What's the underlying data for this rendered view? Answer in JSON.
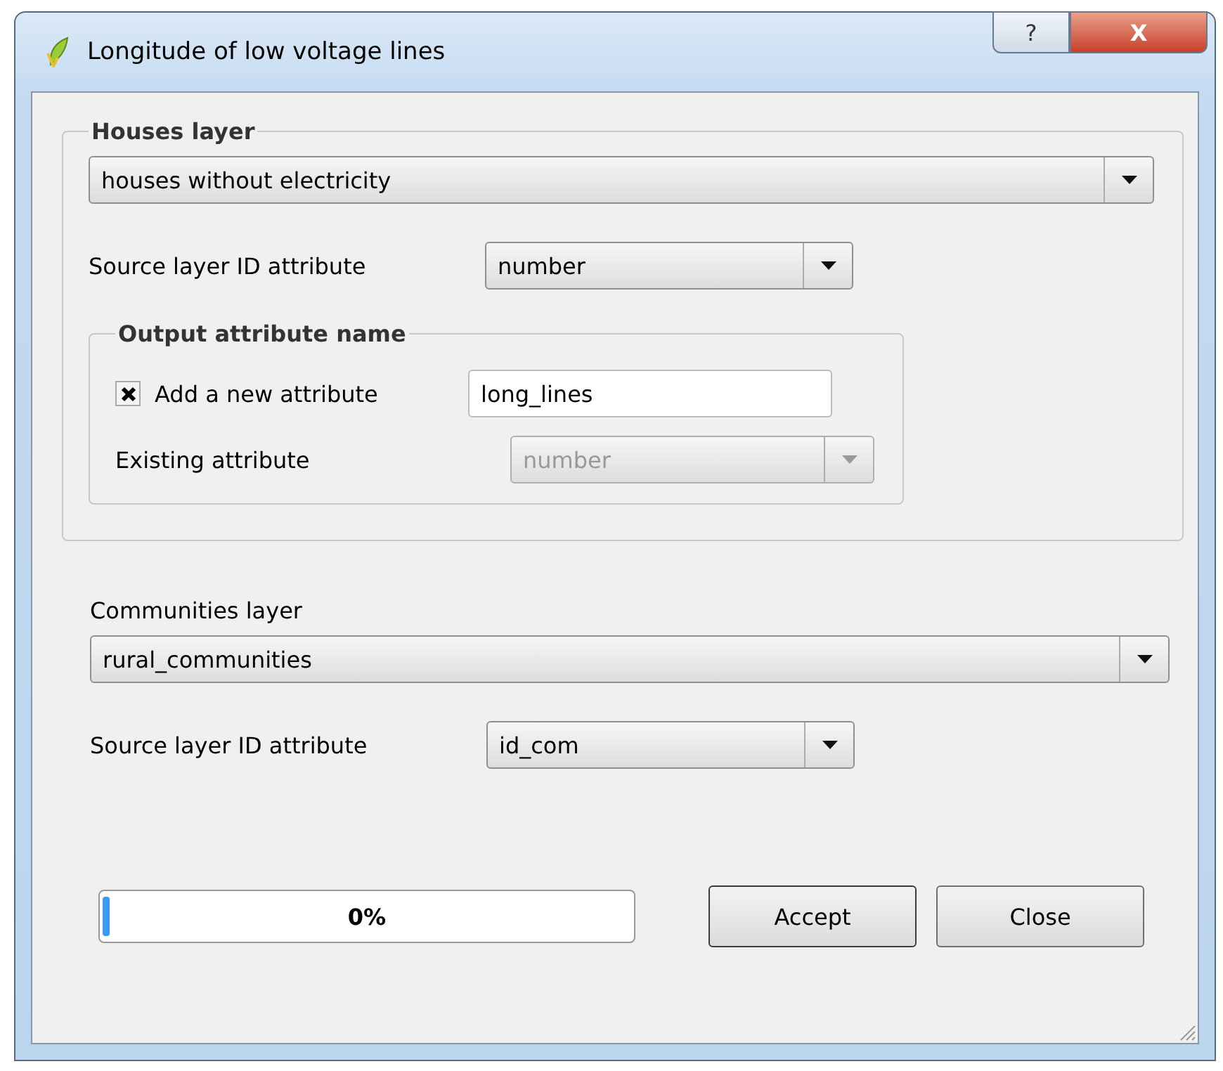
{
  "window": {
    "title": "Longitude of low voltage lines",
    "help_button": "?",
    "close_button": "X"
  },
  "houses_layer": {
    "title": "Houses layer",
    "layer": {
      "value": "houses without electricity",
      "disabled": false
    },
    "source_id": {
      "label": "Source layer ID attribute",
      "value": "number",
      "disabled": false
    },
    "output": {
      "title": "Output attribute name",
      "add_new": {
        "label": "Add a new attribute",
        "checked": true,
        "value": "long_lines"
      },
      "existing": {
        "label": "Existing attribute",
        "value": "number",
        "disabled": true
      }
    }
  },
  "communities_layer": {
    "label": "Communities layer",
    "layer": {
      "value": "rural_communities",
      "disabled": false
    },
    "source_id": {
      "label": "Source layer ID attribute",
      "value": "id_com",
      "disabled": false
    }
  },
  "progress": {
    "level": 0,
    "text": "0%"
  },
  "buttons": [
    {
      "label": "Accept",
      "kind": "default"
    },
    {
      "label": "Close",
      "kind": "normal"
    }
  ]
}
